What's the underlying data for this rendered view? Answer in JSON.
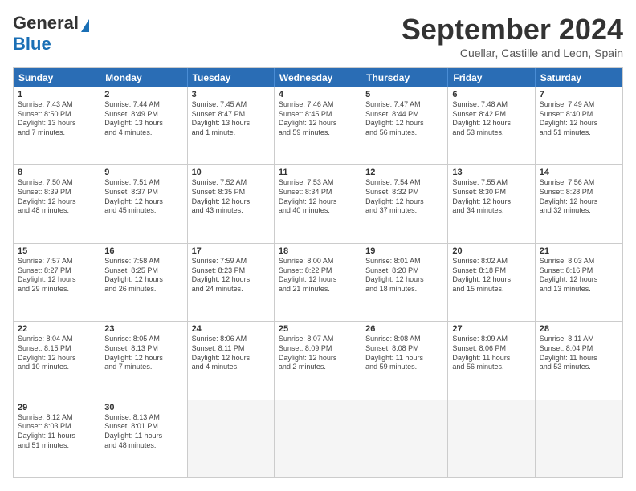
{
  "header": {
    "logo_line1": "General",
    "logo_line2": "Blue",
    "month_title": "September 2024",
    "location": "Cuellar, Castille and Leon, Spain"
  },
  "days_of_week": [
    "Sunday",
    "Monday",
    "Tuesday",
    "Wednesday",
    "Thursday",
    "Friday",
    "Saturday"
  ],
  "weeks": [
    [
      {
        "day": "1",
        "info": "Sunrise: 7:43 AM\nSunset: 8:50 PM\nDaylight: 13 hours\nand 7 minutes."
      },
      {
        "day": "2",
        "info": "Sunrise: 7:44 AM\nSunset: 8:49 PM\nDaylight: 13 hours\nand 4 minutes."
      },
      {
        "day": "3",
        "info": "Sunrise: 7:45 AM\nSunset: 8:47 PM\nDaylight: 13 hours\nand 1 minute."
      },
      {
        "day": "4",
        "info": "Sunrise: 7:46 AM\nSunset: 8:45 PM\nDaylight: 12 hours\nand 59 minutes."
      },
      {
        "day": "5",
        "info": "Sunrise: 7:47 AM\nSunset: 8:44 PM\nDaylight: 12 hours\nand 56 minutes."
      },
      {
        "day": "6",
        "info": "Sunrise: 7:48 AM\nSunset: 8:42 PM\nDaylight: 12 hours\nand 53 minutes."
      },
      {
        "day": "7",
        "info": "Sunrise: 7:49 AM\nSunset: 8:40 PM\nDaylight: 12 hours\nand 51 minutes."
      }
    ],
    [
      {
        "day": "8",
        "info": "Sunrise: 7:50 AM\nSunset: 8:39 PM\nDaylight: 12 hours\nand 48 minutes."
      },
      {
        "day": "9",
        "info": "Sunrise: 7:51 AM\nSunset: 8:37 PM\nDaylight: 12 hours\nand 45 minutes."
      },
      {
        "day": "10",
        "info": "Sunrise: 7:52 AM\nSunset: 8:35 PM\nDaylight: 12 hours\nand 43 minutes."
      },
      {
        "day": "11",
        "info": "Sunrise: 7:53 AM\nSunset: 8:34 PM\nDaylight: 12 hours\nand 40 minutes."
      },
      {
        "day": "12",
        "info": "Sunrise: 7:54 AM\nSunset: 8:32 PM\nDaylight: 12 hours\nand 37 minutes."
      },
      {
        "day": "13",
        "info": "Sunrise: 7:55 AM\nSunset: 8:30 PM\nDaylight: 12 hours\nand 34 minutes."
      },
      {
        "day": "14",
        "info": "Sunrise: 7:56 AM\nSunset: 8:28 PM\nDaylight: 12 hours\nand 32 minutes."
      }
    ],
    [
      {
        "day": "15",
        "info": "Sunrise: 7:57 AM\nSunset: 8:27 PM\nDaylight: 12 hours\nand 29 minutes."
      },
      {
        "day": "16",
        "info": "Sunrise: 7:58 AM\nSunset: 8:25 PM\nDaylight: 12 hours\nand 26 minutes."
      },
      {
        "day": "17",
        "info": "Sunrise: 7:59 AM\nSunset: 8:23 PM\nDaylight: 12 hours\nand 24 minutes."
      },
      {
        "day": "18",
        "info": "Sunrise: 8:00 AM\nSunset: 8:22 PM\nDaylight: 12 hours\nand 21 minutes."
      },
      {
        "day": "19",
        "info": "Sunrise: 8:01 AM\nSunset: 8:20 PM\nDaylight: 12 hours\nand 18 minutes."
      },
      {
        "day": "20",
        "info": "Sunrise: 8:02 AM\nSunset: 8:18 PM\nDaylight: 12 hours\nand 15 minutes."
      },
      {
        "day": "21",
        "info": "Sunrise: 8:03 AM\nSunset: 8:16 PM\nDaylight: 12 hours\nand 13 minutes."
      }
    ],
    [
      {
        "day": "22",
        "info": "Sunrise: 8:04 AM\nSunset: 8:15 PM\nDaylight: 12 hours\nand 10 minutes."
      },
      {
        "day": "23",
        "info": "Sunrise: 8:05 AM\nSunset: 8:13 PM\nDaylight: 12 hours\nand 7 minutes."
      },
      {
        "day": "24",
        "info": "Sunrise: 8:06 AM\nSunset: 8:11 PM\nDaylight: 12 hours\nand 4 minutes."
      },
      {
        "day": "25",
        "info": "Sunrise: 8:07 AM\nSunset: 8:09 PM\nDaylight: 12 hours\nand 2 minutes."
      },
      {
        "day": "26",
        "info": "Sunrise: 8:08 AM\nSunset: 8:08 PM\nDaylight: 11 hours\nand 59 minutes."
      },
      {
        "day": "27",
        "info": "Sunrise: 8:09 AM\nSunset: 8:06 PM\nDaylight: 11 hours\nand 56 minutes."
      },
      {
        "day": "28",
        "info": "Sunrise: 8:11 AM\nSunset: 8:04 PM\nDaylight: 11 hours\nand 53 minutes."
      }
    ],
    [
      {
        "day": "29",
        "info": "Sunrise: 8:12 AM\nSunset: 8:03 PM\nDaylight: 11 hours\nand 51 minutes."
      },
      {
        "day": "30",
        "info": "Sunrise: 8:13 AM\nSunset: 8:01 PM\nDaylight: 11 hours\nand 48 minutes."
      },
      {
        "day": "",
        "info": ""
      },
      {
        "day": "",
        "info": ""
      },
      {
        "day": "",
        "info": ""
      },
      {
        "day": "",
        "info": ""
      },
      {
        "day": "",
        "info": ""
      }
    ]
  ]
}
